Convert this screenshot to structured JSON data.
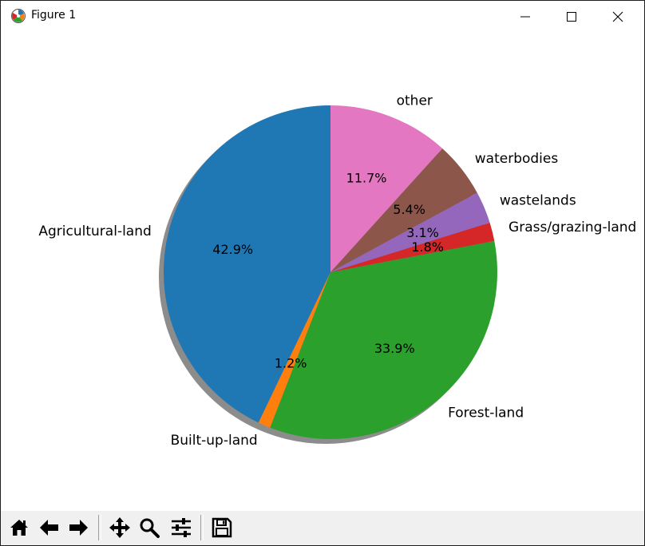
{
  "window": {
    "title": "Figure 1",
    "icons": {
      "app": "matplotlib-icon",
      "minimize": "minimize-icon",
      "maximize": "maximize-icon",
      "close": "close-icon"
    }
  },
  "toolbar": {
    "buttons": [
      {
        "name": "home-button",
        "icon": "home-icon"
      },
      {
        "name": "back-button",
        "icon": "arrow-left-icon"
      },
      {
        "name": "forward-button",
        "icon": "arrow-right-icon"
      },
      {
        "name": "pan-button",
        "icon": "move-icon"
      },
      {
        "name": "zoom-button",
        "icon": "magnifier-icon"
      },
      {
        "name": "configure-subplots-button",
        "icon": "sliders-icon"
      },
      {
        "name": "save-button",
        "icon": "floppy-disk-icon"
      }
    ]
  },
  "chart_data": {
    "type": "pie",
    "title": "",
    "start_angle_deg": 90,
    "direction": "counterclockwise",
    "shadow": true,
    "labels": [
      "Agricultural-land",
      "Built-up-land",
      "Forest-land",
      "Grass/grazing-land",
      "wastelands",
      "waterbodies",
      "other"
    ],
    "values": [
      42.9,
      1.2,
      33.9,
      1.8,
      3.1,
      5.4,
      11.7
    ],
    "autopct": [
      "42.9%",
      "1.2%",
      "33.9%",
      "1.8%",
      "3.1%",
      "5.4%",
      "11.7%"
    ],
    "colors": [
      "#1f77b4",
      "#ff7f0e",
      "#2ca02c",
      "#d62728",
      "#9467bd",
      "#8c564b",
      "#e377c2"
    ]
  }
}
